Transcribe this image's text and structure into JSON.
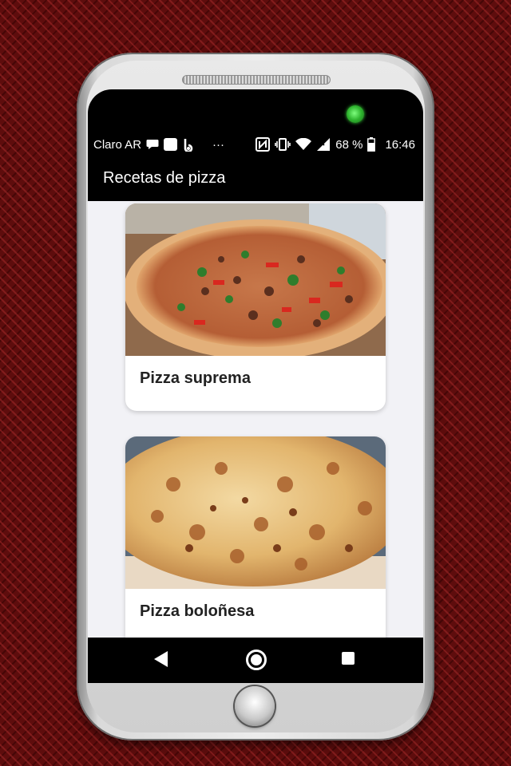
{
  "status_bar": {
    "carrier": "Claro AR",
    "dots": "···",
    "battery": "68 %",
    "time": "16:46",
    "icons": [
      "chat-bubble-icon",
      "square-app-icon",
      "b-app-icon",
      "nfc-icon",
      "vibrate-icon",
      "wifi-icon",
      "signal-icon",
      "battery-icon"
    ]
  },
  "app_bar": {
    "title": "Recetas de pizza"
  },
  "recipes": [
    {
      "name": "Pizza suprema"
    },
    {
      "name": "Pizza boloñesa"
    }
  ],
  "nav_bar": {
    "icons": [
      "back-icon",
      "home-icon",
      "recents-icon"
    ]
  },
  "colors": {
    "background": "#5e0d0d",
    "accent_green": "#2fb52f",
    "content_bg": "#f2f2f6"
  }
}
